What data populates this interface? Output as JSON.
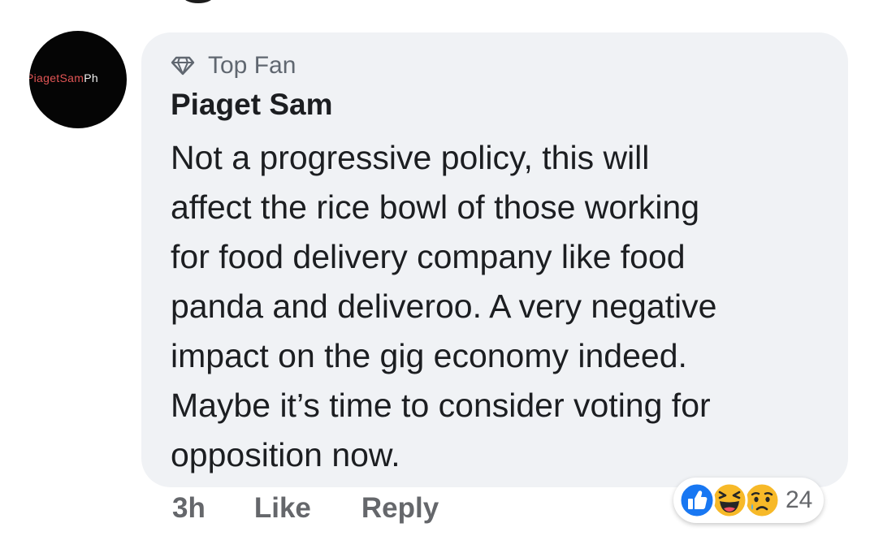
{
  "comment": {
    "badge": "Top Fan",
    "author": "Piaget Sam",
    "avatar_text": "PiagetSam",
    "avatar_text_tail": "Ph",
    "text": "Not a progressive policy, this will\naffect the rice bowl of those working\nfor food delivery company like food\npanda and deliveroo. A very negative\nimpact on the gig economy indeed.\nMaybe it’s time to consider voting for\nopposition now."
  },
  "actions": {
    "timestamp": "3h",
    "like_label": "Like",
    "reply_label": "Reply"
  },
  "reactions": {
    "icons": [
      "like-icon",
      "haha-icon",
      "sad-icon"
    ],
    "count": "24"
  },
  "colors": {
    "bubble": "#f0f2f5",
    "text": "#1c1e21",
    "muted": "#65676b",
    "like_blue": "#1877f2",
    "emoji_yellow": "#f7b928"
  }
}
